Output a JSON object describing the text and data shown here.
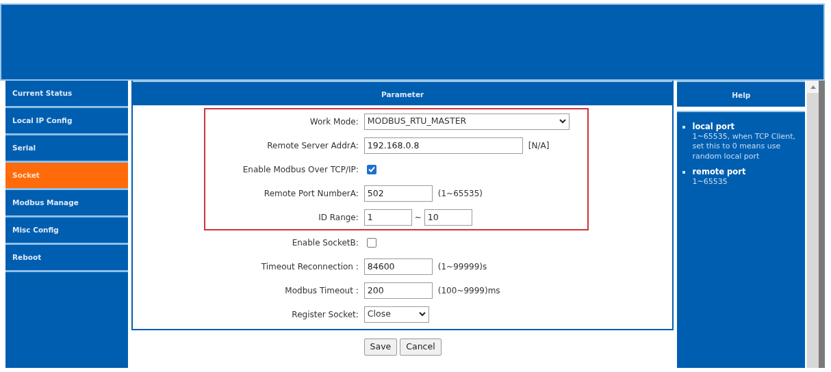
{
  "sidebar": {
    "items": [
      {
        "label": "Current Status",
        "selected": false
      },
      {
        "label": "Local IP Config",
        "selected": false
      },
      {
        "label": "Serial",
        "selected": false
      },
      {
        "label": "Socket",
        "selected": true
      },
      {
        "label": "Modbus Manage",
        "selected": false
      },
      {
        "label": "Misc Config",
        "selected": false
      },
      {
        "label": "Reboot",
        "selected": false
      }
    ]
  },
  "panel": {
    "title": "Parameter",
    "fields": [
      {
        "kind": "select",
        "label": "Work Mode:",
        "value": "MODBUS_RTU_MASTER",
        "highlighted": true
      },
      {
        "kind": "text",
        "label": "Remote Server AddrA:",
        "value": "192.168.0.8",
        "suffix": "[N/A]",
        "highlighted": true
      },
      {
        "kind": "checkbox",
        "label": "Enable Modbus Over TCP/IP:",
        "checked": true,
        "highlighted": true
      },
      {
        "kind": "text",
        "label": "Remote Port NumberA:",
        "value": "502",
        "suffix": "(1~65535)",
        "highlighted": true
      },
      {
        "kind": "range",
        "label": "ID Range:",
        "value": "1",
        "separator": "~",
        "value_to": "10",
        "highlighted": true
      },
      {
        "kind": "checkbox",
        "label": "Enable SocketB:",
        "checked": false,
        "highlighted": false
      },
      {
        "kind": "text",
        "label": "Timeout Reconnection :",
        "value": "84600",
        "suffix": "(1~99999)s",
        "highlighted": false
      },
      {
        "kind": "text",
        "label": "Modbus Timeout :",
        "value": "200",
        "suffix": "(100~9999)ms",
        "highlighted": false
      },
      {
        "kind": "select",
        "label": "Register Socket:",
        "value": "Close",
        "highlighted": false
      }
    ]
  },
  "buttons": [
    "Save",
    "Cancel"
  ],
  "help": {
    "title": "Help",
    "items": [
      {
        "term": "local port",
        "text": "1~65535, when TCP Client, set this to 0 means use random local port"
      },
      {
        "term": "remote port",
        "text": "1~65535"
      }
    ]
  }
}
